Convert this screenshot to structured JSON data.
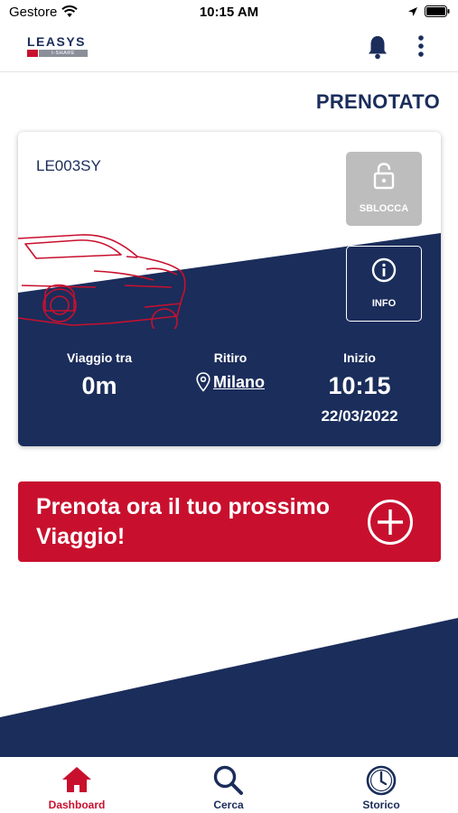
{
  "status_bar": {
    "carrier": "Gestore",
    "time": "10:15 AM"
  },
  "header": {
    "logo_text": "LEASYS",
    "logo_sub": "I-SHARE",
    "bell_icon": "bell-icon",
    "menu_icon": "more-vertical-icon"
  },
  "booking_status": "PRENOTATO",
  "vehicle": {
    "plate": "LE003SY",
    "unlock_label": "SBLOCCA",
    "info_label": "INFO",
    "trip_label": "Viaggio tra",
    "trip_value": "0m",
    "pickup_label": "Ritiro",
    "pickup_location": "Milano",
    "start_label": "Inizio",
    "start_time": "10:15",
    "start_date": "22/03/2022"
  },
  "cta": {
    "text": "Prenota ora il tuo prossimo Viaggio!",
    "icon": "plus-circle-icon"
  },
  "tabs": [
    {
      "label": "Dashboard",
      "icon": "home-icon",
      "active": true
    },
    {
      "label": "Cerca",
      "icon": "search-icon",
      "active": false
    },
    {
      "label": "Storico",
      "icon": "clock-icon",
      "active": false
    }
  ],
  "colors": {
    "navy": "#1b2d5b",
    "red": "#c8102e",
    "disabled_grey": "#bdbdbd"
  }
}
